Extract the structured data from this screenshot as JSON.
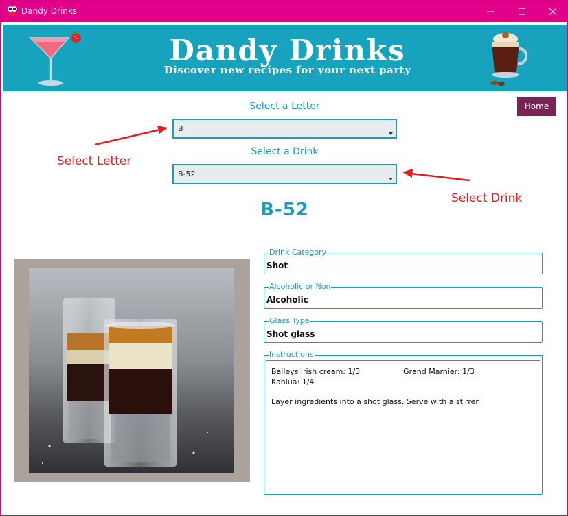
{
  "window": {
    "title": "Dandy Drinks"
  },
  "banner": {
    "title": "Dandy Drinks",
    "subtitle": "Discover new recipes for your next party"
  },
  "nav": {
    "home_label": "Home"
  },
  "selectors": {
    "letter_label": "Select a Letter",
    "letter_value": "B",
    "drink_label": "Select a Drink",
    "drink_value": "B-52"
  },
  "annotations": {
    "letter_note": "Select Letter",
    "drink_note": "Select Drink"
  },
  "drink": {
    "name": "B-52",
    "category_label": "Drink Category",
    "category": "Shot",
    "alcoholic_label": "Alcoholic or Non",
    "alcoholic": "Alcoholic",
    "glass_label": "Glass Type",
    "glass": "Shot glass",
    "instructions_label": "Instructions",
    "ingredients": [
      "Baileys irish cream: 1/3",
      "Grand Marnier: 1/3",
      "Kahlua: 1/4"
    ],
    "instructions": "Layer ingredients into a shot glass. Serve with a stirrer."
  },
  "colors": {
    "titlebar": "#e0008a",
    "banner": "#17a2bd",
    "accent": "#1a9fb4",
    "home_button": "#7a2456",
    "annotation": "#e51c1c"
  }
}
